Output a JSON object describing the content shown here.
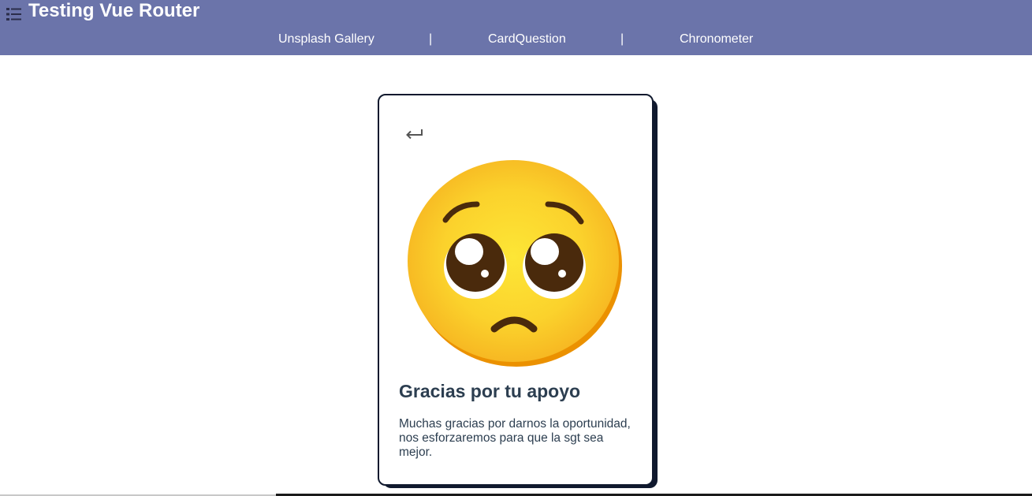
{
  "header": {
    "title": "Testing Vue Router",
    "menu_icon": "list-icon"
  },
  "nav": {
    "items": [
      {
        "label": "Unsplash Gallery"
      },
      {
        "label": "CardQuestion"
      },
      {
        "label": "Chronometer"
      }
    ],
    "separator": "|"
  },
  "card": {
    "back_icon": "return-arrow-icon",
    "emoji_icon": "pleading-face-emoji",
    "title": "Gracias por tu apoyo",
    "text": "Muchas gracias por darnos la oportunidad, nos esforzaremos para que la sgt sea mejor."
  },
  "colors": {
    "header_bg": "#6b74aa",
    "card_border": "#10192e",
    "text": "#2c3e50"
  }
}
